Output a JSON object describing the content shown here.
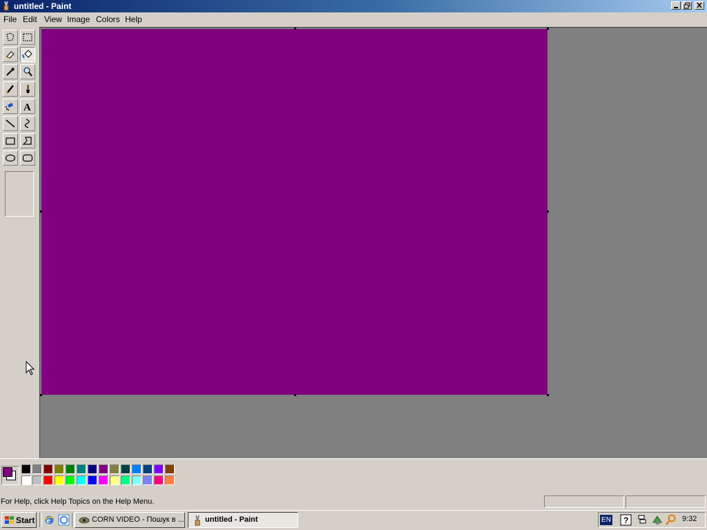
{
  "window": {
    "title": "untitled - Paint"
  },
  "menu": {
    "items": [
      "File",
      "Edit",
      "View",
      "Image",
      "Colors",
      "Help"
    ]
  },
  "tools": [
    {
      "name": "free-form-select",
      "icon": "free-form-select-icon",
      "active": false
    },
    {
      "name": "select",
      "icon": "rect-select-icon",
      "active": false
    },
    {
      "name": "eraser",
      "icon": "eraser-icon",
      "active": false
    },
    {
      "name": "fill-with-color",
      "icon": "paint-bucket-icon",
      "active": true
    },
    {
      "name": "pick-color",
      "icon": "eyedropper-icon",
      "active": false
    },
    {
      "name": "magnifier",
      "icon": "magnifier-icon",
      "active": false
    },
    {
      "name": "pencil",
      "icon": "pencil-icon",
      "active": false
    },
    {
      "name": "brush",
      "icon": "brush-icon",
      "active": false
    },
    {
      "name": "airbrush",
      "icon": "airbrush-icon",
      "active": false
    },
    {
      "name": "text",
      "icon": "text-icon",
      "active": false
    },
    {
      "name": "line",
      "icon": "line-icon",
      "active": false
    },
    {
      "name": "curve",
      "icon": "curve-icon",
      "active": false
    },
    {
      "name": "rectangle",
      "icon": "rectangle-icon",
      "active": false
    },
    {
      "name": "polygon",
      "icon": "polygon-icon",
      "active": false
    },
    {
      "name": "ellipse",
      "icon": "ellipse-icon",
      "active": false
    },
    {
      "name": "rounded-rectangle",
      "icon": "rounded-rectangle-icon",
      "active": false
    }
  ],
  "canvas": {
    "color": "#800080"
  },
  "colors": {
    "foreground": "#800080",
    "background": "#ffffff",
    "palette_top": [
      "#000000",
      "#808080",
      "#800000",
      "#808000",
      "#008000",
      "#008080",
      "#000080",
      "#800080",
      "#808040",
      "#004040",
      "#0080ff",
      "#004080",
      "#8000ff",
      "#804000"
    ],
    "palette_bottom": [
      "#ffffff",
      "#c0c0c0",
      "#ff0000",
      "#ffff00",
      "#00ff00",
      "#00ffff",
      "#0000ff",
      "#ff00ff",
      "#ffff80",
      "#00ff80",
      "#80ffff",
      "#8080ff",
      "#ff0080",
      "#ff8040"
    ]
  },
  "status": {
    "text": "For Help, click Help Topics on the Help Menu."
  },
  "taskbar": {
    "start_label": "Start",
    "quick_launch": [
      "internet-explorer-icon",
      "ie-browser-icon"
    ],
    "tasks": [
      {
        "label": "CORN VIDEO - Пошук в ...",
        "active": false
      },
      {
        "label": "untitled - Paint",
        "active": true
      }
    ],
    "tray": {
      "language": "EN",
      "clock": "9:32"
    }
  }
}
